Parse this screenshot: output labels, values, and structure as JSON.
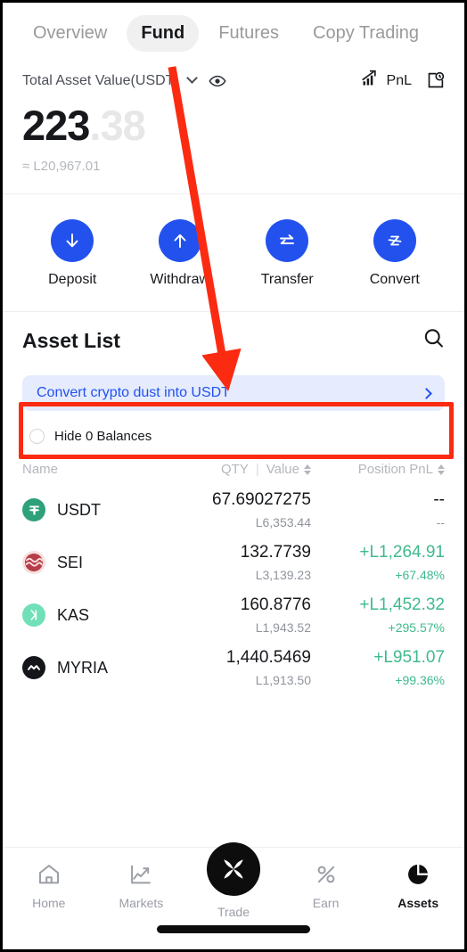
{
  "tabs": [
    {
      "label": "Overview",
      "active": false
    },
    {
      "label": "Fund",
      "active": true
    },
    {
      "label": "Futures",
      "active": false
    },
    {
      "label": "Copy Trading",
      "active": false
    }
  ],
  "balance": {
    "label": "Total Asset Value(USDT)",
    "dropdown_icon": "chevron-down-icon",
    "visibility_icon": "eye-icon",
    "pnl_label": "PnL",
    "pnl_icon": "bar-chart-icon",
    "history_icon": "history-clock-icon",
    "amount_int": "223",
    "amount_dec": ".38",
    "converted": "≈ L20,967.01"
  },
  "actions": [
    {
      "label": "Deposit",
      "icon": "arrow-down-icon"
    },
    {
      "label": "Withdraw",
      "icon": "arrow-up-icon"
    },
    {
      "label": "Transfer",
      "icon": "transfer-arrows-icon"
    },
    {
      "label": "Convert",
      "icon": "convert-z-icon"
    }
  ],
  "asset_list": {
    "title": "Asset List",
    "search_icon": "search-icon",
    "dust_banner": {
      "text": "Convert crypto dust into USDT",
      "chevron_icon": "chevron-right-icon",
      "accent": "#2251ee",
      "background": "#e6ecfd"
    },
    "hide_zero": {
      "label": "Hide 0 Balances",
      "checked": false
    },
    "columns": {
      "name": "Name",
      "qty": "QTY",
      "value": "Value",
      "pnl": "Position PnL"
    },
    "rows": [
      {
        "symbol": "USDT",
        "icon_color": "#2ea07a",
        "qty": "67.69027275",
        "value": "L6,353.44",
        "pnl": "--",
        "pnl_pct": "--",
        "positive": false
      },
      {
        "symbol": "SEI",
        "icon_color": "#b63d4a",
        "qty": "132.7739",
        "value": "L3,139.23",
        "pnl": "+L1,264.91",
        "pnl_pct": "+67.48%",
        "positive": true
      },
      {
        "symbol": "KAS",
        "icon_color": "#70e0b8",
        "qty": "160.8776",
        "value": "L1,943.52",
        "pnl": "+L1,452.32",
        "pnl_pct": "+295.57%",
        "positive": true
      },
      {
        "symbol": "MYRIA",
        "icon_color": "#14161a",
        "qty": "1,440.5469",
        "value": "L1,913.50",
        "pnl": "+L951.07",
        "pnl_pct": "+99.36%",
        "positive": true
      }
    ]
  },
  "bottom_nav": [
    {
      "label": "Home",
      "icon": "home-icon",
      "active": false
    },
    {
      "label": "Markets",
      "icon": "chart-line-icon",
      "active": false
    },
    {
      "label": "Trade",
      "icon": "trade-x-icon",
      "active": false
    },
    {
      "label": "Earn",
      "icon": "percent-icon",
      "active": false
    },
    {
      "label": "Assets",
      "icon": "pie-chart-icon",
      "active": true
    }
  ],
  "annotation": {
    "highlight_color": "#fb2b12",
    "arrow_from": "Fund tab",
    "arrow_to": "Convert crypto dust into USDT banner"
  }
}
